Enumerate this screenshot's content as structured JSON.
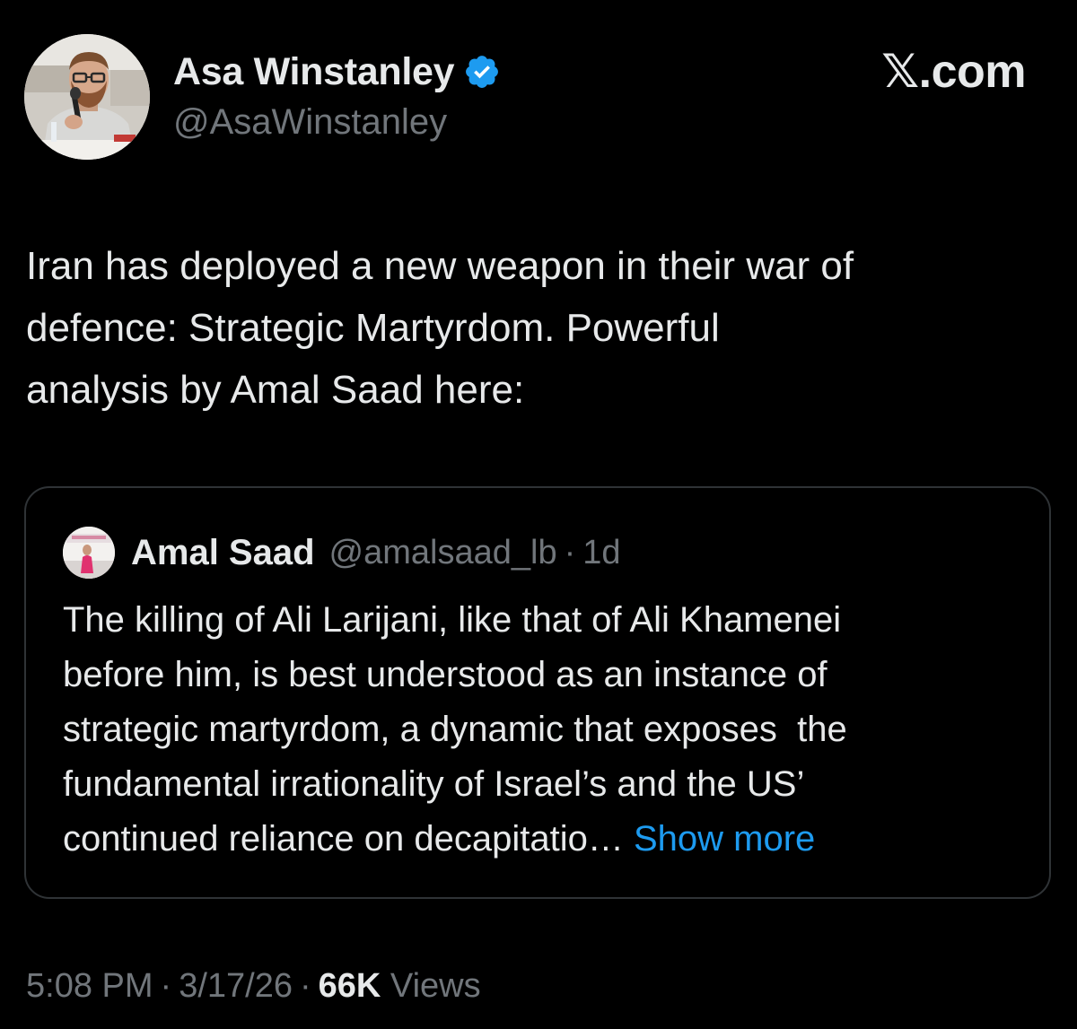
{
  "tweet": {
    "author": {
      "name": "Asa Winstanley",
      "handle": "@AsaWinstanley",
      "verified": true
    },
    "site_label": "𝕏.com",
    "text_lines": [
      "Iran has deployed a new weapon in their war of",
      "defence: Strategic Martyrdom. Powerful",
      "analysis by Amal Saad here:"
    ],
    "quoted": {
      "author_name": "Amal Saad",
      "handle": "@amalsaad_lb",
      "separator": "·",
      "time": "1d",
      "text_lines": [
        "The killing of Ali Larijani, like that of Ali Khamenei",
        "before him, is best understood as an instance of",
        "strategic martyrdom, a dynamic that exposes  the",
        "fundamental irrationality of Israel’s and the US’",
        "continued reliance on decapitatio… "
      ],
      "show_more": "Show more"
    },
    "meta": {
      "time": "5:08 PM",
      "date": "3/17/26",
      "separator": "·",
      "views_count": "66K",
      "views_label": "Views"
    }
  },
  "colors": {
    "background": "#000000",
    "text_primary": "#e7e9ea",
    "text_secondary": "#71767b",
    "link": "#1d9bf0",
    "verified_badge": "#1d9bf0",
    "card_border": "#2f3336"
  },
  "icons": {
    "verified": "verified-badge-icon"
  }
}
